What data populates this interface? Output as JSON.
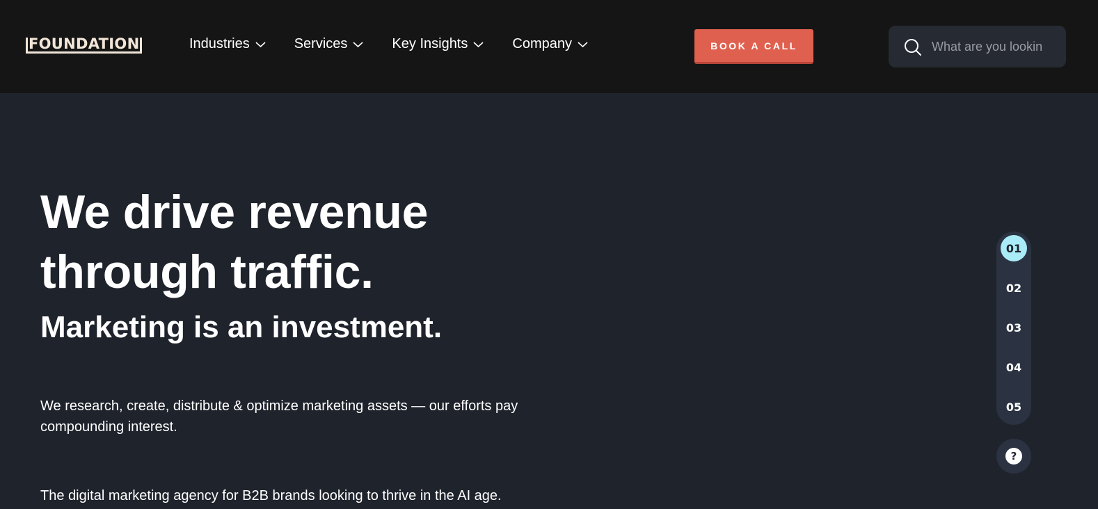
{
  "header": {
    "logo_text": "FOUNDATION",
    "nav": [
      {
        "label": "Industries"
      },
      {
        "label": "Services"
      },
      {
        "label": "Key Insights"
      },
      {
        "label": "Company"
      }
    ],
    "cta_label": "BOOK A CALL",
    "search": {
      "placeholder": "What are you lookin",
      "value": ""
    },
    "icons": {
      "search": "search-icon",
      "dropdown": "chevron-down-icon"
    }
  },
  "hero": {
    "title_line1": "We drive revenue",
    "title_line2": "through traffic.",
    "subtitle": "Marketing is an investment.",
    "paragraph_line1": "We research, create, distribute & optimize marketing assets — our efforts pay",
    "paragraph_line2": "compounding interest.",
    "tagline": "The digital marketing agency for B2B brands looking to thrive in the AI age."
  },
  "slide_nav": {
    "items": [
      "01",
      "02",
      "03",
      "04",
      "05"
    ],
    "active_index": 0,
    "help_label": "?"
  },
  "colors": {
    "header_bg": "#151515",
    "page_bg": "#1f232c",
    "accent": "#e0604f",
    "active_dot": "#a9ecf7",
    "logo": "#f2e6d8"
  }
}
